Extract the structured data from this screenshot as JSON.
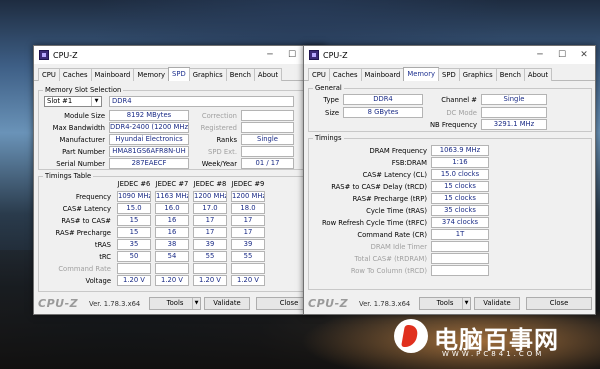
{
  "app_title": "CPU-Z",
  "window_controls": {
    "minimize": "─",
    "maximize": "☐",
    "close": "✕"
  },
  "tabs": [
    "CPU",
    "Caches",
    "Mainboard",
    "Memory",
    "SPD",
    "Graphics",
    "Bench",
    "About"
  ],
  "spd": {
    "active_tab": "SPD",
    "slot_group": "Memory Slot Selection",
    "slot_value": "Slot #1",
    "memory_type": "DDR4",
    "module_size_label": "Module Size",
    "module_size": "8192 MBytes",
    "max_bw_label": "Max Bandwidth",
    "max_bw": "DDR4-2400 (1200 MHz)",
    "manufacturer_label": "Manufacturer",
    "manufacturer": "Hyundai Electronics",
    "part_label": "Part Number",
    "part": "HMA81GS6AFR8N-UH",
    "serial_label": "Serial Number",
    "serial": "287EAECF",
    "correction_label": "Correction",
    "correction": "",
    "registered_label": "Registered",
    "registered": "",
    "ranks_label": "Ranks",
    "ranks": "Single",
    "spd_ext_label": "SPD Ext.",
    "spd_ext": "",
    "week_year_label": "Week/Year",
    "week_year": "01 / 17",
    "timings_group": "Timings Table",
    "jedec_headers": [
      "JEDEC #6",
      "JEDEC #7",
      "JEDEC #8",
      "JEDEC #9"
    ],
    "rows": [
      {
        "label": "Frequency",
        "values": [
          "1090 MHz",
          "1163 MHz",
          "1200 MHz",
          "1200 MHz"
        ],
        "dim": false
      },
      {
        "label": "CAS# Latency",
        "values": [
          "15.0",
          "16.0",
          "17.0",
          "18.0"
        ],
        "dim": false
      },
      {
        "label": "RAS# to CAS#",
        "values": [
          "15",
          "16",
          "17",
          "17"
        ],
        "dim": false
      },
      {
        "label": "RAS# Precharge",
        "values": [
          "15",
          "16",
          "17",
          "17"
        ],
        "dim": false
      },
      {
        "label": "tRAS",
        "values": [
          "35",
          "38",
          "39",
          "39"
        ],
        "dim": false
      },
      {
        "label": "tRC",
        "values": [
          "50",
          "54",
          "55",
          "55"
        ],
        "dim": false
      },
      {
        "label": "Command Rate",
        "values": [
          "",
          "",
          "",
          ""
        ],
        "dim": true
      },
      {
        "label": "Voltage",
        "values": [
          "1.20 V",
          "1.20 V",
          "1.20 V",
          "1.20 V"
        ],
        "dim": false
      }
    ]
  },
  "memory": {
    "active_tab": "Memory",
    "general_group": "General",
    "type_label": "Type",
    "type": "DDR4",
    "size_label": "Size",
    "size": "8 GBytes",
    "channel_label": "Channel #",
    "channel": "Single",
    "dc_mode_label": "DC Mode",
    "dc_mode": "",
    "nb_freq_label": "NB Frequency",
    "nb_freq": "3291.1 MHz",
    "timings_group": "Timings",
    "rows": [
      {
        "label": "DRAM Frequency",
        "value": "1063.9 MHz",
        "dim": false
      },
      {
        "label": "FSB:DRAM",
        "value": "1:16",
        "dim": false
      },
      {
        "label": "CAS# Latency (CL)",
        "value": "15.0 clocks",
        "dim": false
      },
      {
        "label": "RAS# to CAS# Delay (tRCD)",
        "value": "15 clocks",
        "dim": false
      },
      {
        "label": "RAS# Precharge (tRP)",
        "value": "15 clocks",
        "dim": false
      },
      {
        "label": "Cycle Time (tRAS)",
        "value": "35 clocks",
        "dim": false
      },
      {
        "label": "Row Refresh Cycle Time (tRFC)",
        "value": "374 clocks",
        "dim": false
      },
      {
        "label": "Command Rate (CR)",
        "value": "1T",
        "dim": false
      },
      {
        "label": "DRAM Idle Timer",
        "value": "",
        "dim": true
      },
      {
        "label": "Total CAS# (tRDRAM)",
        "value": "",
        "dim": true
      },
      {
        "label": "Row To Column (tRCD)",
        "value": "",
        "dim": true
      }
    ]
  },
  "footer": {
    "brand": "CPU-Z",
    "version": "Ver. 1.78.3.x64",
    "tools": "Tools",
    "validate": "Validate",
    "close": "Close"
  },
  "watermark": {
    "name": "电脑百事网",
    "url": "WWW.PC841.COM"
  }
}
